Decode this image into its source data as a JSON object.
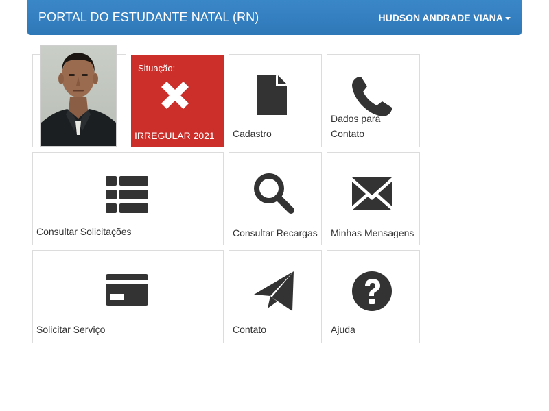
{
  "navbar": {
    "title": "PORTAL DO ESTUDANTE NATAL (RN)",
    "user_name": "HUDSON ANDRADE VIANA"
  },
  "status": {
    "caption": "Situação:",
    "value": "IRREGULAR 2021",
    "icon": "x-icon",
    "color": "#cc2f2a"
  },
  "tiles": {
    "cadastro": {
      "label": "Cadastro",
      "icon": "document-icon"
    },
    "dados_contato": {
      "label": "Dados para Contato",
      "icon": "phone-icon"
    },
    "consultar_solicitacoes": {
      "label": "Consultar Solicitações",
      "icon": "list-icon"
    },
    "consultar_recargas": {
      "label": "Consultar Recargas",
      "icon": "search-icon"
    },
    "minhas_mensagens": {
      "label": "Minhas Mensagens",
      "icon": "envelope-icon"
    },
    "solicitar_servico": {
      "label": "Solicitar Serviço",
      "icon": "credit-card-icon"
    },
    "contato": {
      "label": "Contato",
      "icon": "paper-plane-icon"
    },
    "ajuda": {
      "label": "Ajuda",
      "icon": "question-circle-icon"
    }
  },
  "colors": {
    "navbar": "#337ab7",
    "icon": "#333333",
    "tile_border": "#dcdcdc"
  }
}
